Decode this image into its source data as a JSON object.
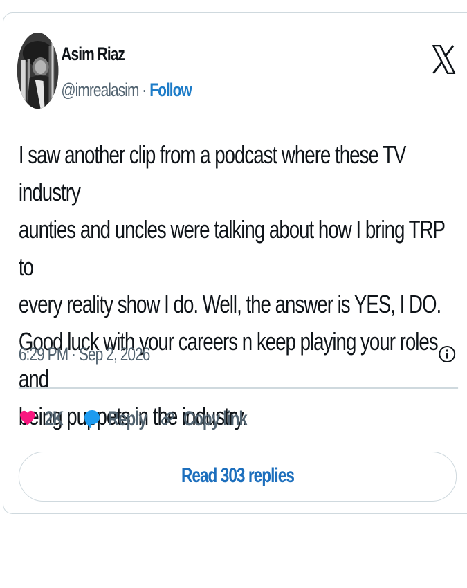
{
  "tweet": {
    "author": {
      "name": "Asim Riaz",
      "handle": "@imrealasim",
      "separator": " · ",
      "follow_label": "Follow"
    },
    "text": "I saw another clip from a podcast where these TV industry\naunties and uncles were talking about how I bring TRP to\nevery reality show I do. Well, the answer is YES, I DO.\nGood luck with your careers n keep playing your roles and\nbeing puppets in the industry.",
    "timestamp": "6:29 PM · Sep 2, 2026",
    "actions": {
      "like_count": "2K",
      "reply_label": "Reply",
      "copy_link_label": "Copy link"
    },
    "read_replies_label": "Read 303 replies"
  },
  "icons": {
    "platform": "x-logo-icon",
    "like": "heart-icon",
    "reply": "speech-bubble-icon",
    "copy": "link-icon",
    "info": "info-icon"
  },
  "colors": {
    "like": "#f91880",
    "reply": "#1d9bf0",
    "follow": "#1d7cc8",
    "border": "#cfd9de",
    "muted": "#536471"
  }
}
